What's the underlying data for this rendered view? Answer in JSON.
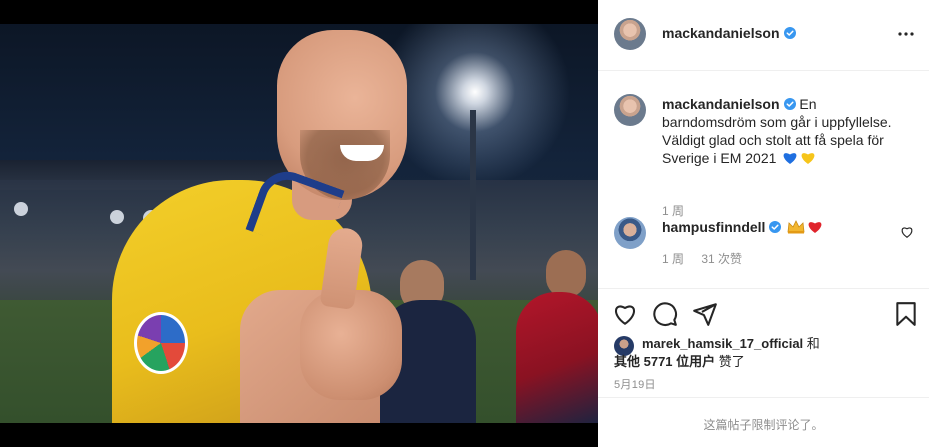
{
  "post": {
    "photo_alt": "Photo by mackandanielson",
    "author": {
      "username": "mackandanielson",
      "verified": true
    },
    "more_icon": "more-horizontal-icon",
    "caption": {
      "username": "mackandanielson",
      "text": "En barndomsdröm som går i uppfyllelse. Väldigt glad och stolt att få spela för Sverige i EM 2021",
      "emojis": [
        "blue-heart",
        "yellow-heart"
      ],
      "time": "1 周"
    },
    "comment": {
      "username": "hampusfinndell",
      "verified": true,
      "emojis": [
        "crown",
        "red-heart"
      ],
      "time": "1 周",
      "likes": "31 次赞",
      "like_icon": "heart-outline-icon"
    },
    "actions": {
      "icons": [
        "heart-outline-icon",
        "comment-icon",
        "share-icon",
        "bookmark-icon"
      ]
    },
    "likes_summary": {
      "first_liker": "marek_hamsik_17_official",
      "conjunction": " 和",
      "others": "其他 5771 位用户",
      "suffix": " 赞了"
    },
    "date": "5月19日",
    "comments_notice": "这篇帖子限制评论了。"
  },
  "colors": {
    "verified_blue": "#3897f0",
    "meta_gray": "#8e8e8e",
    "text": "#262626",
    "border": "#efefef"
  }
}
